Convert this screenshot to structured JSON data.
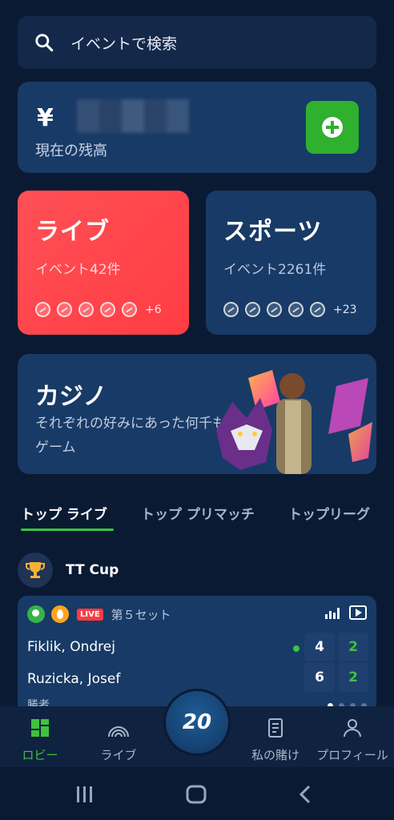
{
  "search": {
    "label": "イベントで検索"
  },
  "balance": {
    "currency": "¥",
    "caption": "現在の残高"
  },
  "tiles": {
    "live": {
      "title": "ライブ",
      "subtitle": "イベント42件",
      "more": "+6"
    },
    "sports": {
      "title": "スポーツ",
      "subtitle": "イベント2261件",
      "more": "+23"
    }
  },
  "casino": {
    "title": "カジノ",
    "description": "それぞれの好みにあった何千ものゲーム"
  },
  "tabs": [
    "トップ ライブ",
    "トップ プリマッチ",
    "トップリーグ"
  ],
  "league": {
    "name": "TT Cup"
  },
  "match": {
    "live_badge": "LIVE",
    "set": "第５セット",
    "players": [
      {
        "name": "Fiklik, Ondrej",
        "game": "4",
        "sets": "2"
      },
      {
        "name": "Ruzicka, Josef",
        "game": "6",
        "sets": "2"
      }
    ],
    "winner_label": "勝者"
  },
  "nav": {
    "lobby": "ロビー",
    "live": "ライブ",
    "fab": "20",
    "my_bets": "私の賭け",
    "profile": "プロフィール"
  },
  "colors": {
    "accent_green": "#3ec23e",
    "live_red": "#ff4f56",
    "card_blue": "#183a66",
    "background": "#0b1a33"
  }
}
